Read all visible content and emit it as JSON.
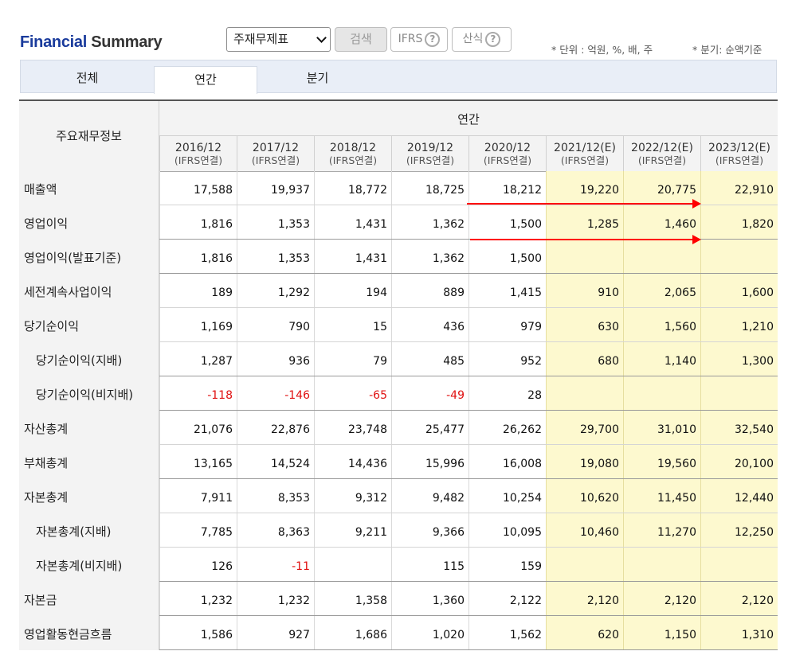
{
  "title": {
    "part1": "Financial",
    "part2": "Summary"
  },
  "toolbar": {
    "statement_select": "주재무제표",
    "search_label": "검색",
    "ifrs_label": "IFRS",
    "formula_label": "산식",
    "help_icon": "?"
  },
  "notes": {
    "unit": "* 단위 : 억원, %, 배, 주",
    "quarter": "* 분기: 순액기준"
  },
  "tabs": [
    "전체",
    "연간",
    "분기"
  ],
  "table": {
    "label_header": "주요재무정보",
    "group_header": "연간",
    "columns": [
      {
        "year": "2016/12",
        "sub": "(IFRS연결)"
      },
      {
        "year": "2017/12",
        "sub": "(IFRS연결)"
      },
      {
        "year": "2018/12",
        "sub": "(IFRS연결)"
      },
      {
        "year": "2019/12",
        "sub": "(IFRS연결)"
      },
      {
        "year": "2020/12",
        "sub": "(IFRS연결)"
      },
      {
        "year": "2021/12(E)",
        "sub": "(IFRS연결)"
      },
      {
        "year": "2022/12(E)",
        "sub": "(IFRS연결)"
      },
      {
        "year": "2023/12(E)",
        "sub": "(IFRS연결)"
      }
    ],
    "rows": [
      {
        "label": "매출액",
        "values": [
          "17,588",
          "19,937",
          "18,772",
          "18,725",
          "18,212",
          "19,220",
          "20,775",
          "22,910"
        ]
      },
      {
        "label": "영업이익",
        "values": [
          "1,816",
          "1,353",
          "1,431",
          "1,362",
          "1,500",
          "1,285",
          "1,460",
          "1,820"
        ]
      },
      {
        "label": "영업이익(발표기준)",
        "values": [
          "1,816",
          "1,353",
          "1,431",
          "1,362",
          "1,500",
          "",
          "",
          ""
        ]
      },
      {
        "label": "세전계속사업이익",
        "values": [
          "189",
          "1,292",
          "194",
          "889",
          "1,415",
          "910",
          "2,065",
          "1,600"
        ]
      },
      {
        "label": "당기순이익",
        "values": [
          "1,169",
          "790",
          "15",
          "436",
          "979",
          "630",
          "1,560",
          "1,210"
        ]
      },
      {
        "label": "당기순이익(지배)",
        "values": [
          "1,287",
          "936",
          "79",
          "485",
          "952",
          "680",
          "1,140",
          "1,300"
        ]
      },
      {
        "label": "당기순이익(비지배)",
        "values": [
          "-118",
          "-146",
          "-65",
          "-49",
          "28",
          "",
          "",
          ""
        ]
      },
      {
        "label": "자산총계",
        "values": [
          "21,076",
          "22,876",
          "23,748",
          "25,477",
          "26,262",
          "29,700",
          "31,010",
          "32,540"
        ]
      },
      {
        "label": "부채총계",
        "values": [
          "13,165",
          "14,524",
          "14,436",
          "15,996",
          "16,008",
          "19,080",
          "19,560",
          "20,100"
        ]
      },
      {
        "label": "자본총계",
        "values": [
          "7,911",
          "8,353",
          "9,312",
          "9,482",
          "10,254",
          "10,620",
          "11,450",
          "12,440"
        ]
      },
      {
        "label": "자본총계(지배)",
        "values": [
          "7,785",
          "8,363",
          "9,211",
          "9,366",
          "10,095",
          "10,460",
          "11,270",
          "12,250"
        ]
      },
      {
        "label": "자본총계(비지배)",
        "values": [
          "126",
          "-11",
          "",
          "115",
          "159",
          "",
          "",
          ""
        ]
      },
      {
        "label": "자본금",
        "values": [
          "1,232",
          "1,232",
          "1,358",
          "1,360",
          "2,122",
          "2,120",
          "2,120",
          "2,120"
        ]
      },
      {
        "label": "영업활동현금흐름",
        "values": [
          "1,586",
          "927",
          "1,686",
          "1,020",
          "1,562",
          "620",
          "1,150",
          "1,310"
        ]
      }
    ]
  },
  "colors": {
    "estimate_bg": "#fdf9cf",
    "negative": "#e01010",
    "annotation_arrow": "#ff0000",
    "title_blue": "#1a3b9c"
  }
}
